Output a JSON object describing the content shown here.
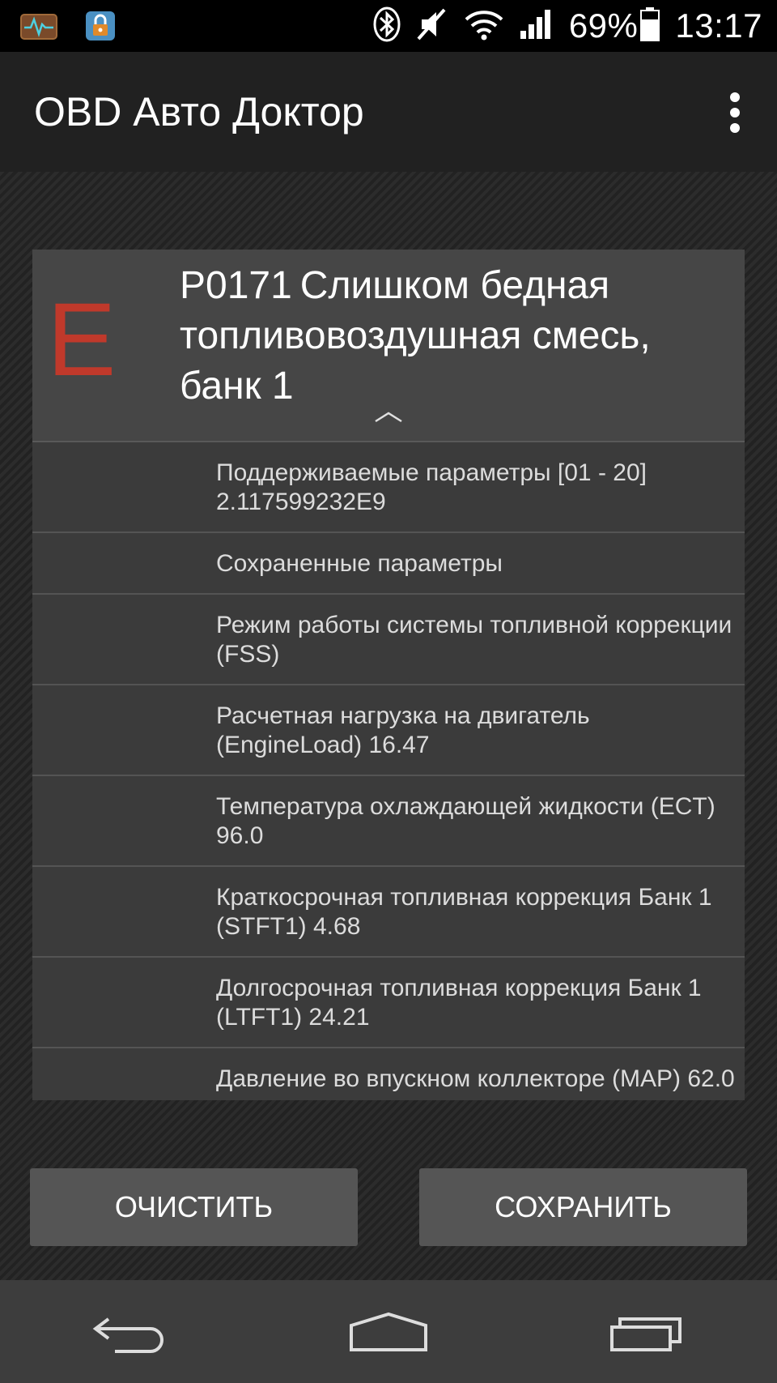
{
  "status_bar": {
    "battery_percent": "69%",
    "time": "13:17",
    "icons": [
      "activity-monitor-icon",
      "app-lock-icon",
      "bluetooth-icon",
      "sound-muted-icon",
      "wifi-icon",
      "signal-icon",
      "battery-icon"
    ]
  },
  "app": {
    "title": "OBD Авто Доктор"
  },
  "dtc": {
    "type_letter": "E",
    "code": "P0171",
    "description": "Слишком бедная топливовоздушная смесь, банк 1",
    "letter_color": "#c0392b"
  },
  "params": [
    {
      "text": "Поддерживаемые параметры [01 - 20] 2.117599232E9"
    },
    {
      "text": "Сохраненные параметры"
    },
    {
      "text": "Режим работы системы топливной коррекции (FSS)"
    },
    {
      "text": "Расчетная нагрузка на двигатель (EngineLoad) 16.47"
    },
    {
      "text": "Температура охлаждающей жидкости (ECT) 96.0"
    },
    {
      "text": "Краткосрочная топливная коррекция Банк 1 (STFT1) 4.68"
    },
    {
      "text": "Долгосрочная топливная коррекция Банк 1 (LTFT1) 24.21"
    },
    {
      "text": "Давление во впускном коллекторе (MAP) 62.0"
    }
  ],
  "buttons": {
    "clear": "ОЧИСТИТЬ",
    "save": "СОХРАНИТЬ"
  }
}
